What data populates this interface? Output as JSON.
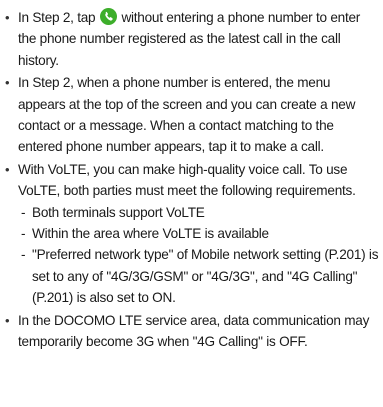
{
  "bullets": [
    {
      "text_before_icon": "In Step 2, tap",
      "icon": "phone-call-icon",
      "text_after_icon": "without entering a phone number to enter the phone number registered as the latest call in the call history."
    },
    {
      "text": "In Step 2, when a phone number is entered, the menu appears at the top of the screen and you can create a new contact or a message. When a contact matching to the entered phone number appears, tap it to make a call."
    },
    {
      "text": "With VoLTE, you can make high-quality voice call. To use VoLTE, both parties must meet the following requirements.",
      "sub_items": [
        "Both terminals support VoLTE",
        "Within the area where VoLTE is available",
        "\"Preferred network type\" of Mobile network setting (P.201) is set to any of \"4G/3G/GSM\" or \"4G/3G\", and \"4G Calling\" (P.201) is also set to ON."
      ]
    },
    {
      "text": "In the DOCOMO LTE service area, data communication may temporarily become 3G when \"4G Calling\" is OFF."
    }
  ],
  "bullet_symbol": "•",
  "dash_symbol": "-",
  "colors": {
    "icon_green": "#3dae2b",
    "text": "#1a1a1a"
  }
}
